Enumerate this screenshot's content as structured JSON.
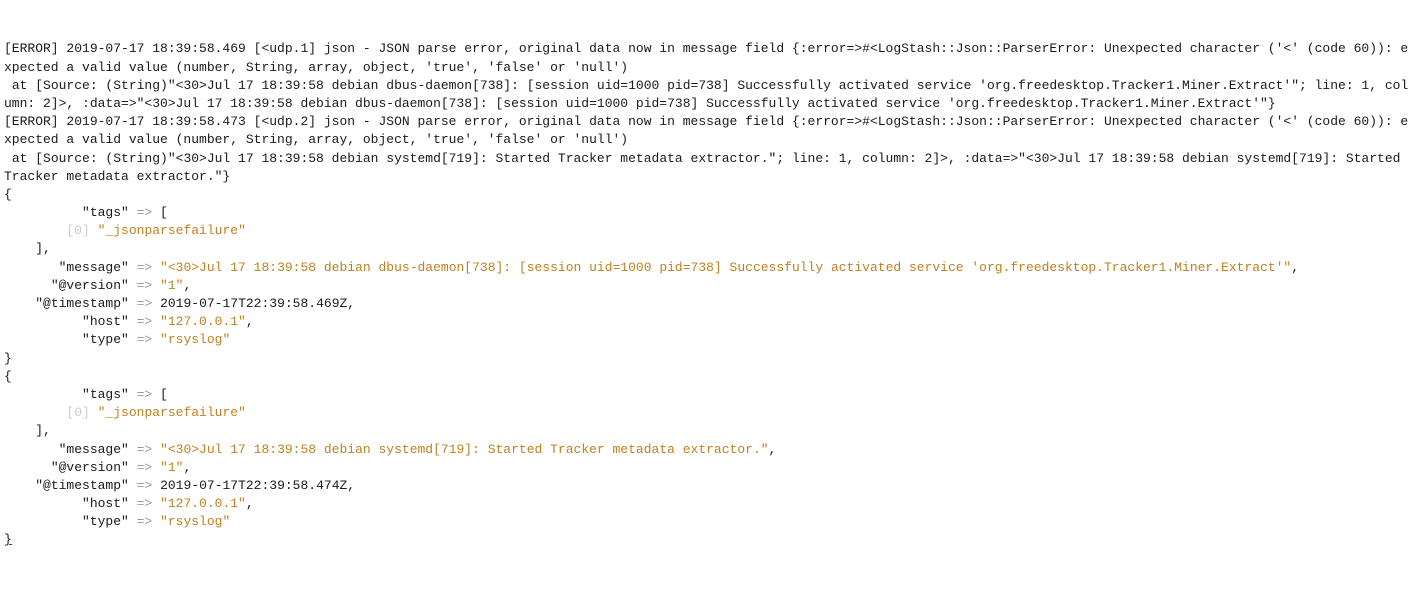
{
  "log": {
    "err1_line1": "[ERROR] 2019-07-17 18:39:58.469 [<udp.1] json - JSON parse error, original data now in message field {:error=>#<LogStash::Json::ParserError: Unexpected character ('<' (code 60)): expected a valid value (number, String, array, object, 'true', 'false' or 'null')",
    "err1_line2": " at [Source: (String)\"<30>Jul 17 18:39:58 debian dbus-daemon[738]: [session uid=1000 pid=738] Successfully activated service 'org.freedesktop.Tracker1.Miner.Extract'\"; line: 1, column: 2]>, :data=>\"<30>Jul 17 18:39:58 debian dbus-daemon[738]: [session uid=1000 pid=738] Successfully activated service 'org.freedesktop.Tracker1.Miner.Extract'\"}",
    "err2_line1": "[ERROR] 2019-07-17 18:39:58.473 [<udp.2] json - JSON parse error, original data now in message field {:error=>#<LogStash::Json::ParserError: Unexpected character ('<' (code 60)): expected a valid value (number, String, array, object, 'true', 'false' or 'null')",
    "err2_line2": " at [Source: (String)\"<30>Jul 17 18:39:58 debian systemd[719]: Started Tracker metadata extractor.\"; line: 1, column: 2]>, :data=>\"<30>Jul 17 18:39:58 debian systemd[719]: Started Tracker metadata extractor.\"}"
  },
  "event1": {
    "open": "{",
    "tags_key": "          \"tags\"",
    "tags_open": "[",
    "idx0": "        [0] ",
    "tags_val": "\"_jsonparsefailure\"",
    "tags_close": "    ],",
    "msg_key": "       \"message\"",
    "msg_val": "\"<30>Jul 17 18:39:58 debian dbus-daemon[738]: [session uid=1000 pid=738] Successfully activated service 'org.freedesktop.Tracker1.Miner.Extract'\"",
    "ver_key": "      \"@version\"",
    "ver_val": "\"1\"",
    "ts_key": "    \"@timestamp\"",
    "ts_val": "2019-07-17T22:39:58.469Z",
    "host_key": "          \"host\"",
    "host_val": "\"127.0.0.1\"",
    "type_key": "          \"type\"",
    "type_val": "\"rsyslog\"",
    "close": "}",
    "arrow": " => ",
    "comma": ","
  },
  "event2": {
    "open": "{",
    "tags_key": "          \"tags\"",
    "tags_open": "[",
    "idx0": "        [0] ",
    "tags_val": "\"_jsonparsefailure\"",
    "tags_close": "    ],",
    "msg_key": "       \"message\"",
    "msg_val": "\"<30>Jul 17 18:39:58 debian systemd[719]: Started Tracker metadata extractor.\"",
    "ver_key": "      \"@version\"",
    "ver_val": "\"1\"",
    "ts_key": "    \"@timestamp\"",
    "ts_val": "2019-07-17T22:39:58.474Z",
    "host_key": "          \"host\"",
    "host_val": "\"127.0.0.1\"",
    "type_key": "          \"type\"",
    "type_val": "\"rsyslog\"",
    "close": "}",
    "arrow": " => ",
    "comma": ","
  }
}
